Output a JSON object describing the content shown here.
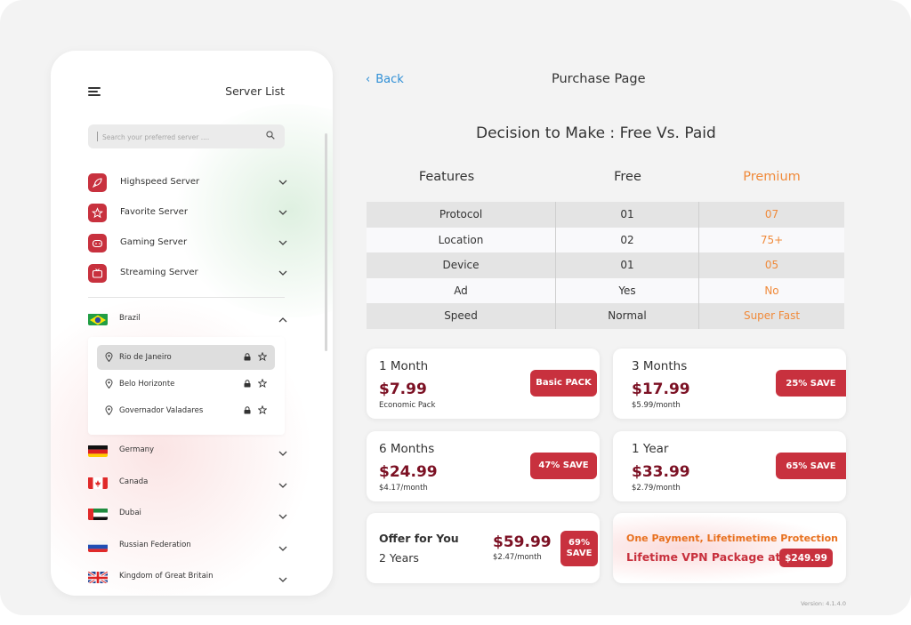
{
  "sidebar": {
    "title": "Server List",
    "search_placeholder": "Search your preferred server ....",
    "categories": [
      {
        "label": "Highspeed Server",
        "icon": "rocket-icon"
      },
      {
        "label": "Favorite Server",
        "icon": "star-icon"
      },
      {
        "label": "Gaming Server",
        "icon": "gamepad-icon"
      },
      {
        "label": "Streaming Server",
        "icon": "tv-icon"
      }
    ],
    "countries": [
      {
        "label": "Brazil",
        "flag": "brazil-flag",
        "expanded": true
      },
      {
        "label": "Germany",
        "flag": "germany-flag"
      },
      {
        "label": "Canada",
        "flag": "canada-flag"
      },
      {
        "label": "Dubai",
        "flag": "uae-flag"
      },
      {
        "label": "Russian Federation",
        "flag": "russia-flag"
      },
      {
        "label": "Kingdom of Great Britain",
        "flag": "uk-flag"
      }
    ],
    "cities": [
      {
        "label": "Rio de Janeiro",
        "selected": true
      },
      {
        "label": "Belo Horizonte"
      },
      {
        "label": "Governador Valadares"
      }
    ]
  },
  "header": {
    "back_label": "Back",
    "title": "Purchase Page"
  },
  "comparison": {
    "heading": "Decision to Make : Free Vs. Paid",
    "columns": [
      "Features",
      "Free",
      "Premium"
    ],
    "rows": [
      [
        "Protocol",
        "01",
        "07"
      ],
      [
        "Location",
        "02",
        "75+"
      ],
      [
        "Device",
        "01",
        "05"
      ],
      [
        "Ad",
        "Yes",
        "No"
      ],
      [
        "Speed",
        "Normal",
        "Super Fast"
      ]
    ]
  },
  "plans": [
    {
      "period": "1 Month",
      "price": "$7.99",
      "sub": "Economic Pack",
      "tag": "Basic PACK"
    },
    {
      "period": "3 Months",
      "price": "$17.99",
      "sub": "$5.99/month",
      "tag": "25% SAVE"
    },
    {
      "period": "6 Months",
      "price": "$24.99",
      "sub": "$4.17/month",
      "tag": "47% SAVE"
    },
    {
      "period": "1 Year",
      "price": "$33.99",
      "sub": "$2.79/month",
      "tag": "65% SAVE"
    }
  ],
  "offer": {
    "line1": "Offer for You",
    "line2": "2 Years",
    "price": "$59.99",
    "sub": "$2.47/month",
    "tag_line1": "69%",
    "tag_line2": "SAVE"
  },
  "lifetime": {
    "line1": "One Payment, Lifetimetime Protection",
    "line2": "Lifetime VPN Package at",
    "price": "$249.99"
  },
  "version": "Version: 4.1.4.0",
  "colors": {
    "accent_red": "#c8313e",
    "price_maroon": "#7c1124",
    "premium_orange": "#f08a3a",
    "link_blue": "#2f8fd6"
  }
}
